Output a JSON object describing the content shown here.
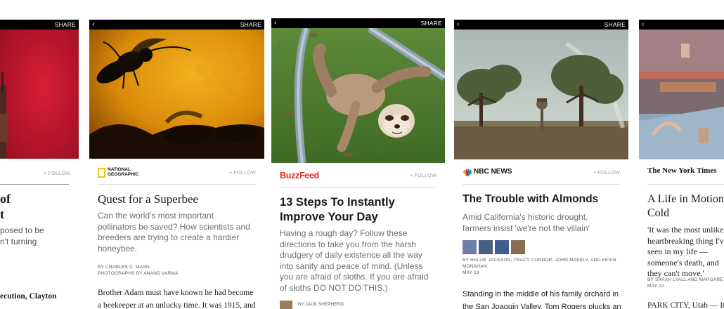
{
  "cards": {
    "c0": {
      "share": "SHARE",
      "follow": "+ FOLLOW",
      "title_lines": [
        "of",
        "t"
      ],
      "summary_lines": [
        "posed to be",
        "n't turning"
      ],
      "body": "ecution, Clayton"
    },
    "c1": {
      "share": "SHARE",
      "publisher_line1": "NATIONAL",
      "publisher_line2": "GEOGRAPHIC",
      "follow": "+ FOLLOW",
      "title": "Quest for a Superbee",
      "summary": "Can the world's most important pollinators be saved? How scientists and breeders are trying to create a hardier honeybee.",
      "byline_line1": "BY CHARLES C. MANN",
      "byline_line2": "PHOTOGRAPHS BY ANAND VARMA",
      "body": "Brother Adam must have known he had become a beekeeper at an unlucky time. It was 1915, and he"
    },
    "c2": {
      "share": "SHARE",
      "publisher": "BuzzFeed",
      "follow": "+ FOLLOW",
      "title": "13 Steps To Instantly Improve Your Day",
      "summary": "Having a rough day? Follow these directions to take you from the harsh drudgery of daily existence all the way into sanity and peace of mind. (Unless you are afraid of sloths. If you are afraid of sloths DO NOT DO THIS.)",
      "byline": "BY JACK SHEPHERD"
    },
    "c3": {
      "share": "SHARE",
      "publisher": "NBC NEWS",
      "follow": "+ FOLLOW",
      "title": "The Trouble with Almonds",
      "summary": "Amid California's historic drought, farmers insist 'we're not the villain'",
      "byline": "BY HALLIE JACKSON, TRACY CONNOR, JOHN MAKELY, AND KEVIN MONAHAN",
      "date": "MAY 13",
      "body": "Standing in the middle of his family orchard in the San Joaquin Valley, Tom Rogers plucks an"
    },
    "c4": {
      "share": "SHARE",
      "publisher": "The New York Times",
      "title": "A Life in Motion, Cold",
      "summary": "'It was the most unlikely, heartbreaking thing I've seen in my life — someone's death, and they can't move.'",
      "byline": "BY SARAH LYALL AND MARGARET",
      "date": "MAY 12",
      "body": "PARK CITY, Utah — It was"
    }
  },
  "colors": {
    "buzzfeed": "#e32a1e",
    "nbc_text": "#111111",
    "topbar": "#000000"
  }
}
